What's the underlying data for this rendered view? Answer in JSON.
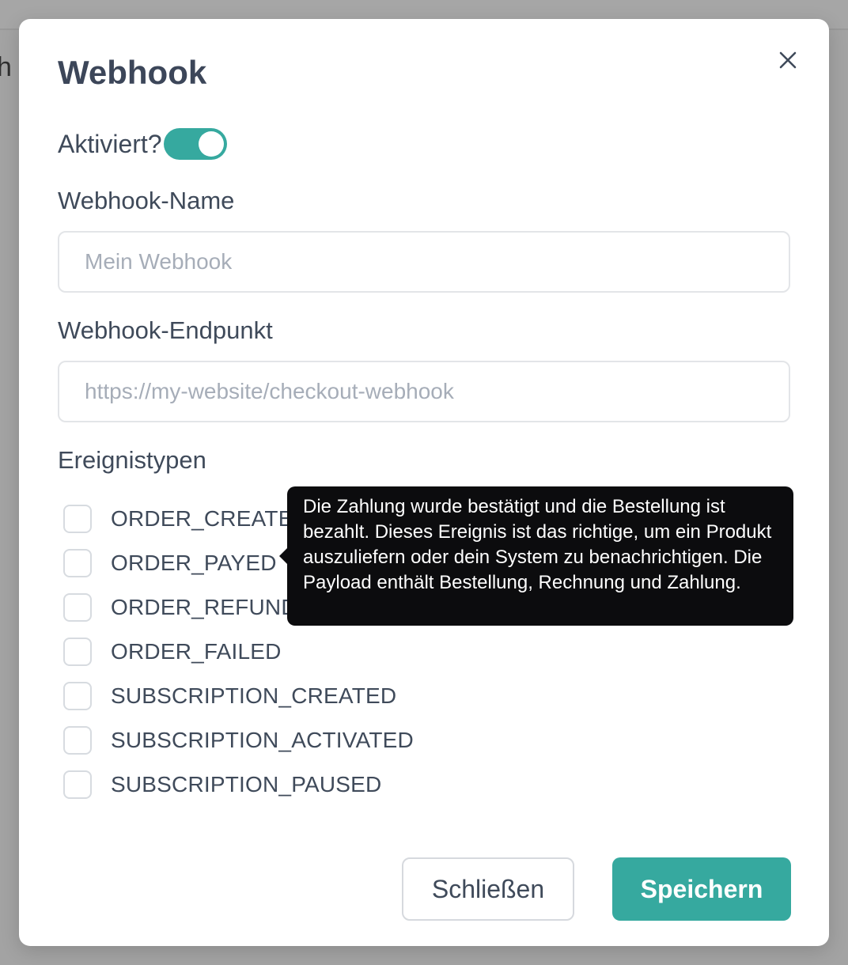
{
  "background": {
    "partial_text": "h"
  },
  "modal": {
    "title": "Webhook",
    "close_icon": "close-icon",
    "activated_label": "Aktiviert?",
    "activated": true,
    "name_label": "Webhook-Name",
    "name_value": "",
    "name_placeholder": "Mein Webhook",
    "endpoint_label": "Webhook-Endpunkt",
    "endpoint_value": "",
    "endpoint_placeholder": "https://my-website/checkout-webhook",
    "events_label": "Ereignistypen",
    "events": [
      {
        "label": "ORDER_CREATED",
        "checked": false
      },
      {
        "label": "ORDER_PAYED",
        "checked": false
      },
      {
        "label": "ORDER_REFUNDED",
        "checked": false
      },
      {
        "label": "ORDER_FAILED",
        "checked": false
      },
      {
        "label": "SUBSCRIPTION_CREATED",
        "checked": false
      },
      {
        "label": "SUBSCRIPTION_ACTIVATED",
        "checked": false
      },
      {
        "label": "SUBSCRIPTION_PAUSED",
        "checked": false
      }
    ],
    "tooltip": "Die Zahlung wurde bestätigt und die Bestellung ist bezahlt. Dieses Ereignis ist das richtige, um ein Produkt auszuliefern oder dein System zu benachrichtigen. Die Payload enthält Bestellung, Rechnung und Zahlung.",
    "close_button": "Schließen",
    "save_button": "Speichern"
  },
  "colors": {
    "accent": "#36a99f",
    "tooltip_bg": "#0c0c0e",
    "text": "#3f4a5a",
    "overlay": "#a3a3a3"
  }
}
